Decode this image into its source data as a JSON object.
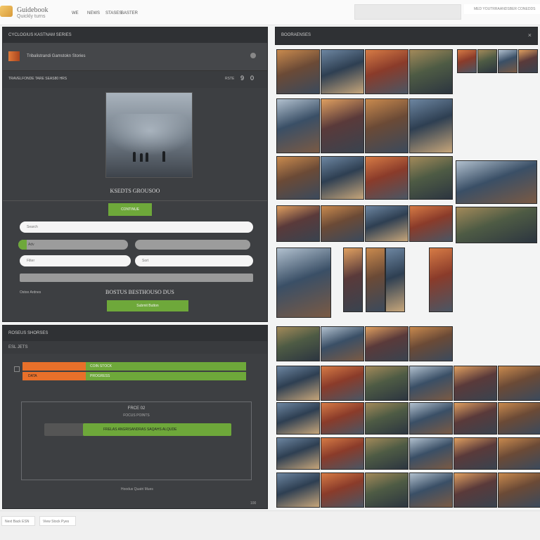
{
  "header": {
    "app_name": "Guidebook",
    "app_sub": "Quickly turns",
    "nav": [
      "WE",
      "NEWS",
      "STASES",
      "BASTER"
    ],
    "top_right": "MED  YOUTRRAANDSBER CONEDDS"
  },
  "left_panel": {
    "title": "CYCLOGIUS KASTNAM SERIES",
    "row1_label": "Tribalistrandi Gamstokn Stories",
    "row2_label": "TRAVELFONDE  TARE SEAS80  HRS",
    "row2_right": "RSTE",
    "row2_count": "9",
    "row2_count2": "0",
    "hero_title": "KSEDTS GROUSOO",
    "primary_button": "CONTINUE",
    "field1_placeholder": "Search",
    "grey1_label": "Adv",
    "grey2_label": "",
    "field2_label": "Filter",
    "field3_label": "Sort",
    "bottom_left": "Ostoo  Ardnes",
    "bottom_title": "BOSTUS BESTHOUSO DUS",
    "submit_button": "Submit Button"
  },
  "left_panel2": {
    "title": "ROSEUS SHORSES",
    "sub_label": "ESL JETS",
    "bar1_label": "COIN STOCK",
    "bar2_label": "DATA",
    "bar3_label": "PROGRESS",
    "inner_title": "FRCE 02",
    "inner_sub": "FOCUS POINTS",
    "inner_bar_label": "FRELAS ANGRISANDRAS SAQAHS ALQUDE",
    "footer_note": "Hoodus Quatri Mues",
    "footer_right": "100"
  },
  "right_panel": {
    "title": "BOORAENSES"
  },
  "footer": {
    "btn1": "Next  Back  ESN",
    "btn2": "View  Stock  Pyes"
  },
  "colors": {
    "accent_green": "#6ea83a",
    "accent_orange": "#e8702a",
    "panel_dark": "#3d3f42"
  },
  "progress": {
    "bar1_fill": 0.29,
    "bar2_fill": 0.71,
    "inner_bar_fill": 0.9
  }
}
